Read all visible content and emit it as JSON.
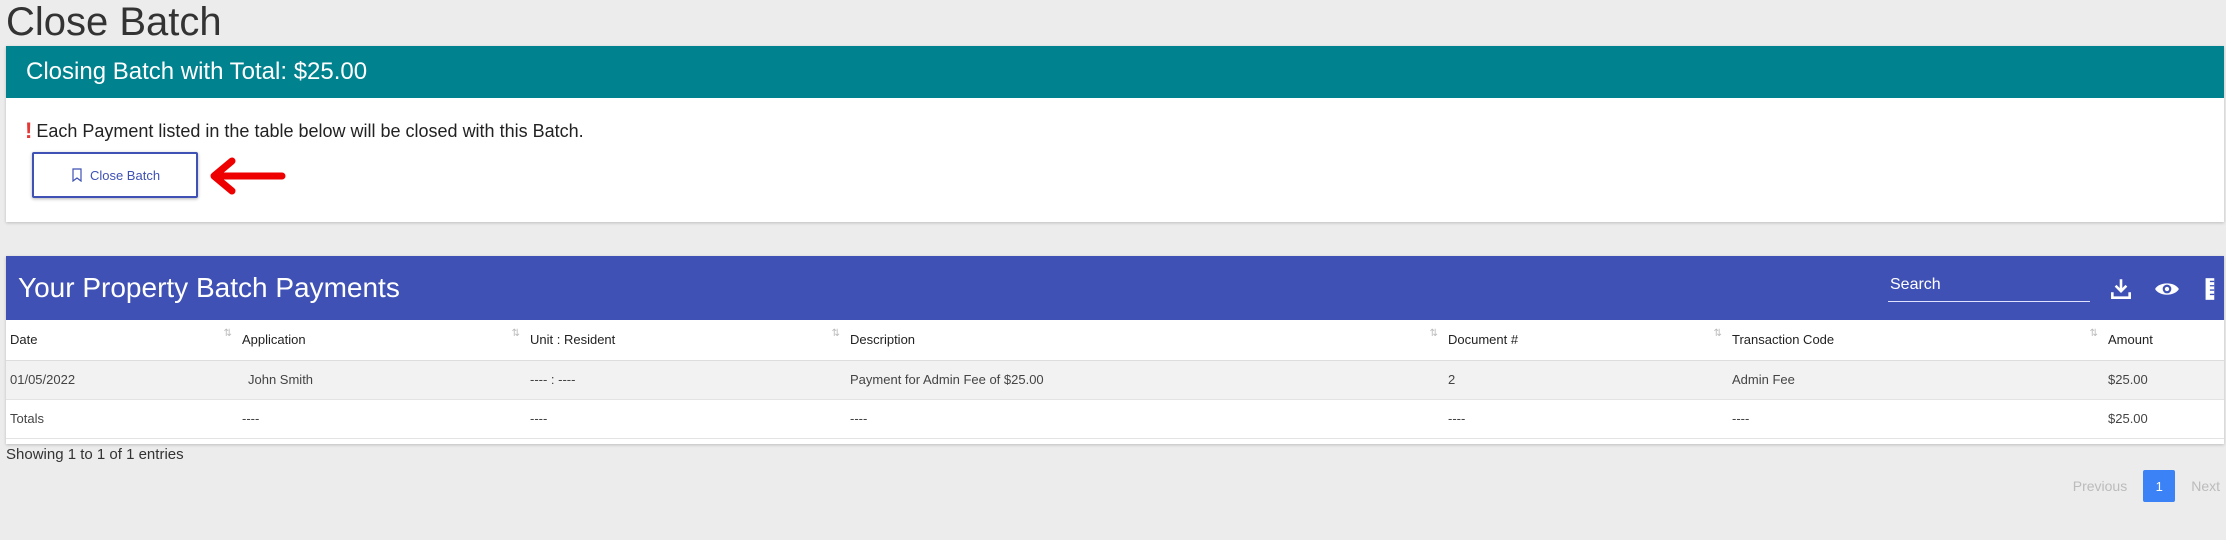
{
  "page": {
    "title": "Close Batch"
  },
  "close_card": {
    "header": "Closing Batch with Total: $25.00",
    "notice": "Each Payment listed in the table below will be closed with this Batch.",
    "button_label": "Close Batch"
  },
  "payments": {
    "title": "Your Property Batch Payments",
    "search_placeholder": "Search",
    "columns": [
      "Date",
      "Application",
      "Unit : Resident",
      "Description",
      "Document #",
      "Transaction Code",
      "Amount"
    ],
    "rows": [
      [
        "01/05/2022",
        "John Smith",
        "---- : ----",
        "Payment for Admin Fee of $25.00",
        "2",
        "Admin Fee",
        "$25.00"
      ],
      [
        "Totals",
        "----",
        "----",
        "----",
        "----",
        "----",
        "$25.00"
      ]
    ],
    "showing": "Showing 1 to 1 of 1 entries",
    "pager": {
      "previous": "Previous",
      "current": "1",
      "next": "Next"
    }
  },
  "colors": {
    "teal_header": "#00838f",
    "indigo_header": "#3f51b5",
    "alert_red": "#e53935",
    "page_active": "#3b82f6"
  },
  "icons": [
    "exclamation-icon",
    "bookmark-icon",
    "red-arrow-icon",
    "download-icon",
    "eye-icon",
    "columns-icon",
    "sort-icon"
  ]
}
